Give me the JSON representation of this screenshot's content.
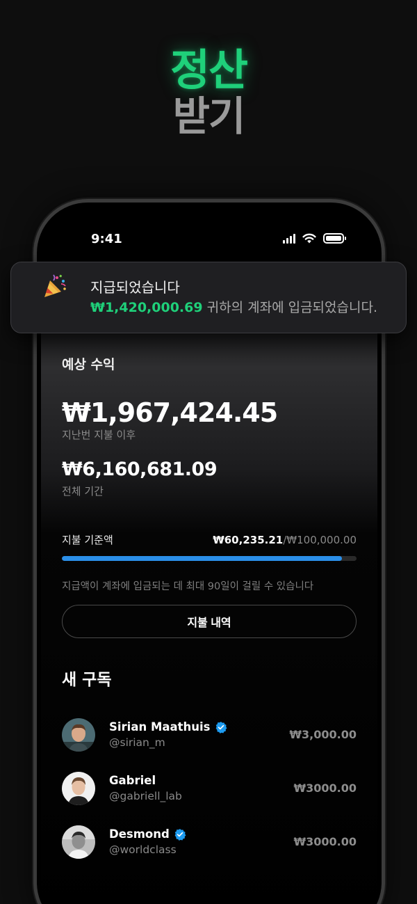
{
  "hero": {
    "line1": "정산",
    "line2": "받기"
  },
  "status_bar": {
    "time": "9:41",
    "icons": [
      "signal-icon",
      "wifi-icon",
      "battery-icon"
    ]
  },
  "notification": {
    "icon": "party-popper-icon",
    "title": "지급되었습니다",
    "amount": "₩1,420,000.69",
    "message": " 귀하의 계좌에 입금되었습니다."
  },
  "earnings": {
    "label": "예상 수익",
    "since_last_amount": "₩1,967,424.45",
    "since_last_caption": "지난번 지불 이후",
    "total_amount": "₩6,160,681.09",
    "total_caption": "전체 기간"
  },
  "payout_threshold": {
    "label": "지불 기준액",
    "current": "₩60,235.21",
    "separator": "/",
    "max": "₩100,000.00",
    "progress_fraction": 0.95,
    "note": "지급액이 계좌에 입금되는 데 최대 90일이 걸릴 수 있습니다"
  },
  "history_button": {
    "label": "지불 내역"
  },
  "subscriptions": {
    "title": "새 구독",
    "items": [
      {
        "name": "Sirian Maathuis",
        "handle": "@sirian_m",
        "amount": "₩3,000.00",
        "verified": true
      },
      {
        "name": "Gabriel",
        "handle": "@gabriell_lab",
        "amount": "₩3000.00",
        "verified": false
      },
      {
        "name": "Desmond",
        "handle": "@worldclass",
        "amount": "₩3000.00",
        "verified": true
      }
    ]
  },
  "colors": {
    "accent_green": "#1fd07a",
    "progress_blue": "#2b8fe8",
    "verified_blue": "#1d9bf0"
  }
}
